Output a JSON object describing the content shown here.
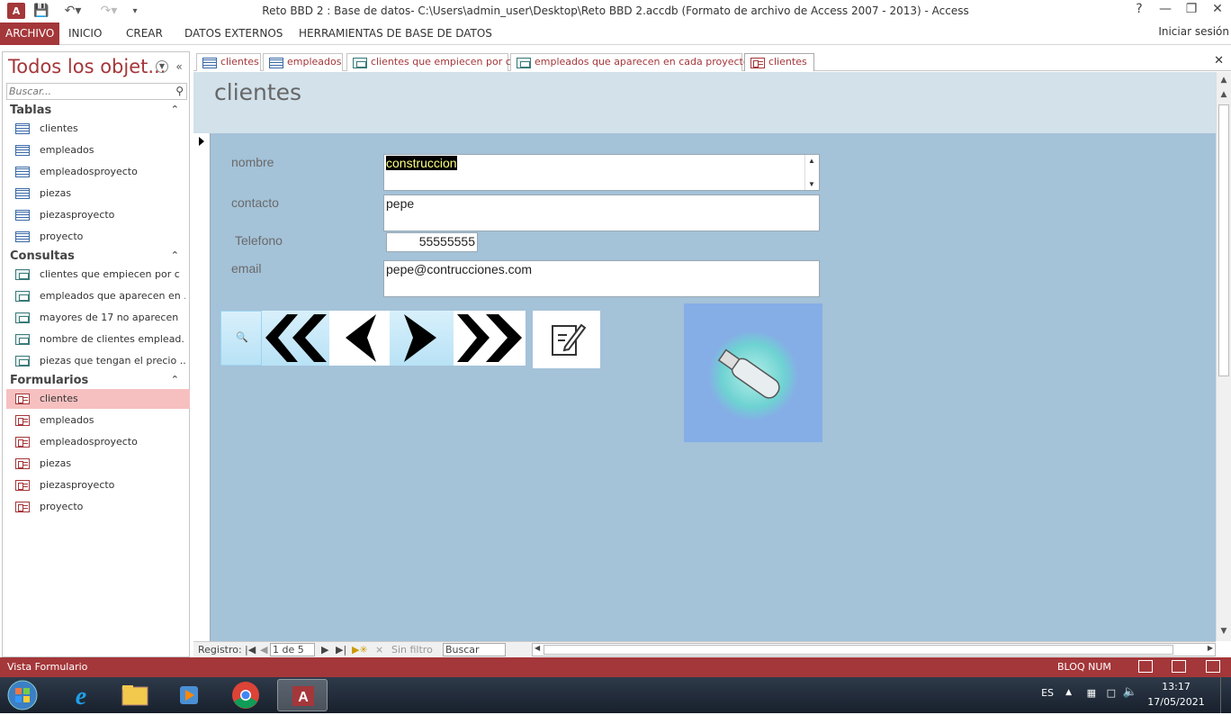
{
  "window": {
    "title": "Reto BBD 2 : Base de datos- C:\\Users\\admin_user\\Desktop\\Reto BBD 2.accdb (Formato de archivo de Access 2007 - 2013) - Access",
    "help": "?",
    "minimize": "—",
    "restore": "❐",
    "close": "✕"
  },
  "ribbon": {
    "tabs": [
      "ARCHIVO",
      "INICIO",
      "CREAR",
      "DATOS EXTERNOS",
      "HERRAMIENTAS DE BASE DE DATOS"
    ],
    "signin": "Iniciar sesión"
  },
  "nav": {
    "title": "Todos los objet...",
    "search_placeholder": "Buscar...",
    "groups": {
      "tablas": "Tablas",
      "consultas": "Consultas",
      "formularios": "Formularios"
    },
    "tables": [
      "clientes",
      "empleados",
      "empleadosproyecto",
      "piezas",
      "piezasproyecto",
      "proyecto"
    ],
    "queries": [
      "clientes que empiecen por c",
      "empleados que aparecen en ...",
      "mayores de 17 no aparecen",
      "nombre de clientes emplead...",
      "piezas que tengan el precio ..."
    ],
    "forms": [
      "clientes",
      "empleados",
      "empleadosproyecto",
      "piezas",
      "piezasproyecto",
      "proyecto"
    ]
  },
  "doctabs": [
    "clientes",
    "empleados",
    "clientes que empiecen por c",
    "empleados que aparecen en cada proyecto",
    "clientes"
  ],
  "form": {
    "title": "clientes",
    "labels": {
      "nombre": "nombre",
      "contacto": "contacto",
      "telefono": "Telefono",
      "email": "email"
    },
    "values": {
      "nombre": "construccion",
      "contacto": "pepe",
      "telefono": "55555555",
      "email": "pepe@contrucciones.com"
    }
  },
  "recordnav": {
    "label": "Registro:",
    "current": "1 de 5",
    "filter": "Sin filtro",
    "search": "Buscar"
  },
  "status": {
    "left": "Vista Formulario",
    "numlock": "BLOQ NUM"
  },
  "taskbar": {
    "lang": "ES",
    "time": "13:17",
    "date": "17/05/2021"
  },
  "colors": {
    "accent": "#a4373a",
    "form_bg": "#a4c2d8",
    "header_bg": "#d2e1ea"
  }
}
